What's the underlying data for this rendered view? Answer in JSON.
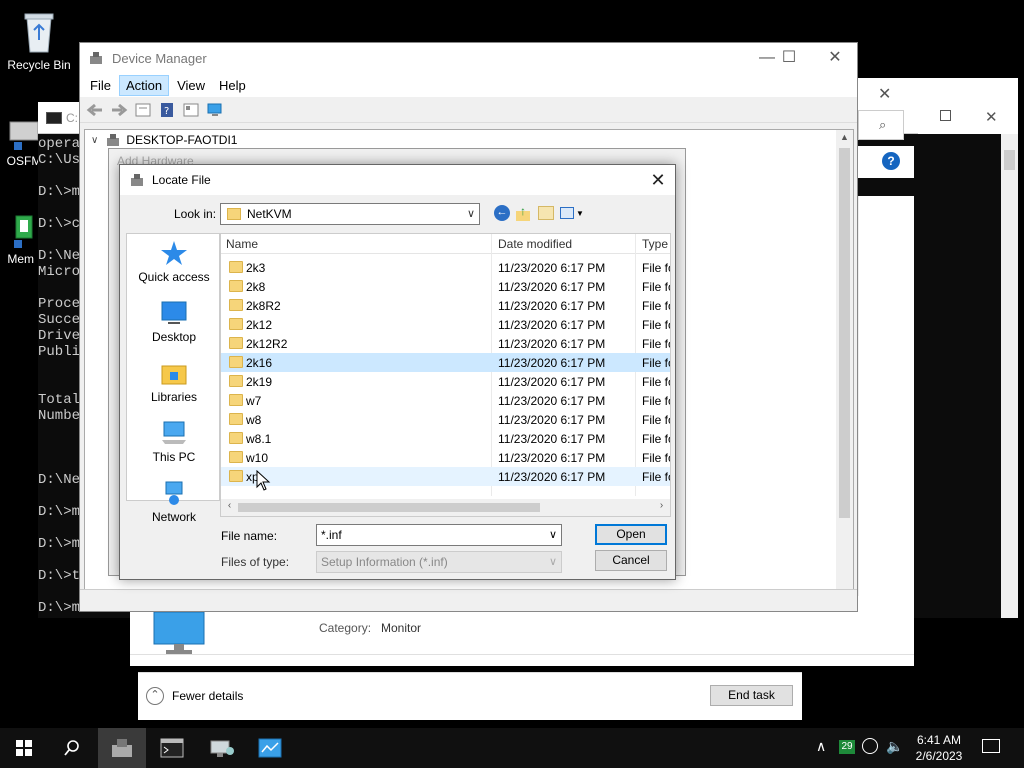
{
  "desktop": {
    "recycle_bin": "Recycle Bin",
    "osfm": "OSFM",
    "mem": "Mem I"
  },
  "console": {
    "title_fragment": "C:",
    "lines": [
      "opera",
      "C:\\Us",
      "",
      "D:\\>m",
      "",
      "D:\\>c",
      "",
      "D:\\Ne",
      "Micro",
      "",
      "Proce",
      "Succe",
      "Drive",
      "Publi",
      "",
      "",
      "Total",
      "Numbe",
      "",
      "",
      "",
      "D:\\Ne",
      "",
      "D:\\>m",
      "",
      "D:\\>m",
      "",
      "D:\\>t",
      "",
      "D:\\>m"
    ]
  },
  "device_manager": {
    "title": "Device Manager",
    "menu": [
      {
        "label": "File",
        "active": false
      },
      {
        "label": "Action",
        "active": true
      },
      {
        "label": "View",
        "active": false
      },
      {
        "label": "Help",
        "active": false
      }
    ],
    "tree_root": "DESKTOP-FAOTDI1"
  },
  "add_hardware": {
    "title": "Add Hardware"
  },
  "dialog": {
    "title": "Locate File",
    "look_in_label": "Look in:",
    "look_in_value": "NetKVM",
    "places": [
      "Quick access",
      "Desktop",
      "Libraries",
      "This PC",
      "Network"
    ],
    "columns": [
      "Name",
      "Date modified",
      "Type"
    ],
    "files": [
      {
        "name": "2k3",
        "date": "11/23/2020 6:17 PM",
        "type": "File fo",
        "state": ""
      },
      {
        "name": "2k8",
        "date": "11/23/2020 6:17 PM",
        "type": "File fo",
        "state": ""
      },
      {
        "name": "2k8R2",
        "date": "11/23/2020 6:17 PM",
        "type": "File fo",
        "state": ""
      },
      {
        "name": "2k12",
        "date": "11/23/2020 6:17 PM",
        "type": "File fo",
        "state": ""
      },
      {
        "name": "2k12R2",
        "date": "11/23/2020 6:17 PM",
        "type": "File fo",
        "state": ""
      },
      {
        "name": "2k16",
        "date": "11/23/2020 6:17 PM",
        "type": "File fo",
        "state": "selected"
      },
      {
        "name": "2k19",
        "date": "11/23/2020 6:17 PM",
        "type": "File fo",
        "state": ""
      },
      {
        "name": "w7",
        "date": "11/23/2020 6:17 PM",
        "type": "File fo",
        "state": ""
      },
      {
        "name": "w8",
        "date": "11/23/2020 6:17 PM",
        "type": "File fo",
        "state": ""
      },
      {
        "name": "w8.1",
        "date": "11/23/2020 6:17 PM",
        "type": "File fo",
        "state": ""
      },
      {
        "name": "w10",
        "date": "11/23/2020 6:17 PM",
        "type": "File fo",
        "state": ""
      },
      {
        "name": "xp",
        "date": "11/23/2020 6:17 PM",
        "type": "File fo",
        "state": "hover"
      }
    ],
    "file_name_label": "File name:",
    "file_name_value": "*.inf",
    "file_type_label": "Files of type:",
    "file_type_value": "Setup Information (*.inf)",
    "open_label": "Open",
    "cancel_label": "Cancel"
  },
  "task_manager": {
    "category_label": "Category:",
    "category_value": "Monitor",
    "fewer_details": "Fewer details",
    "end_task": "End task"
  },
  "taskbar": {
    "time": "6:41 AM",
    "date": "2/6/2023",
    "tray_badge": "29"
  },
  "colors": {
    "selection": "#cce8ff",
    "accent": "#0078d7",
    "folder": "#f6d57a"
  }
}
